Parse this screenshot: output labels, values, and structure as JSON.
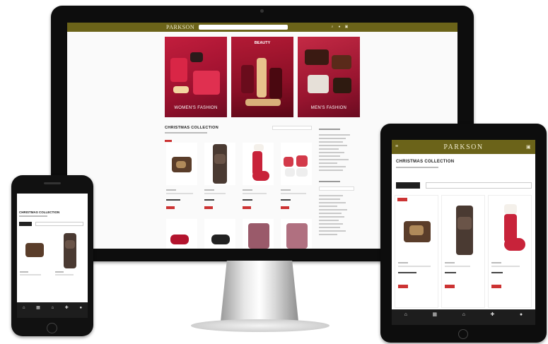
{
  "desktop": {
    "brand": "PARKSON",
    "nav_icons": [
      "search-icon",
      "user-icon",
      "cart-icon"
    ],
    "banners": [
      {
        "label": "WOMEN'S FASHION"
      },
      {
        "label": "MEN'S FASHION"
      }
    ],
    "banner_beauty_label": "BEAUTY",
    "collection_title": "CHRISTMAS COLLECTION",
    "products": [
      {
        "name": "watch-gift-box"
      },
      {
        "name": "reindeer-plush"
      },
      {
        "name": "christmas-stocking"
      },
      {
        "name": "gift-jars"
      }
    ]
  },
  "phone": {
    "title": "CHRISTMAS COLLECTION",
    "sort_button": "",
    "products": [
      {
        "name": "watch-gift-box"
      },
      {
        "name": "reindeer-plush"
      }
    ],
    "tab_bar": [
      "home-icon",
      "category-icon",
      "store-icon",
      "promo-icon",
      "account-icon"
    ]
  },
  "tablet": {
    "brand": "PARKSON",
    "title": "CHRISTMAS COLLECTION",
    "sort_button": "",
    "filter_placeholder": "",
    "products": [
      {
        "name": "watch-gift-box"
      },
      {
        "name": "reindeer-plush"
      },
      {
        "name": "christmas-stocking"
      }
    ],
    "tab_bar": [
      "home-icon",
      "category-icon",
      "store-icon",
      "promo-icon",
      "account-icon"
    ]
  },
  "colors": {
    "brand_olive": "#6b6319",
    "accent_red": "#c33333",
    "banner_red": "#b31a35",
    "device_black": "#0d0d0d"
  }
}
